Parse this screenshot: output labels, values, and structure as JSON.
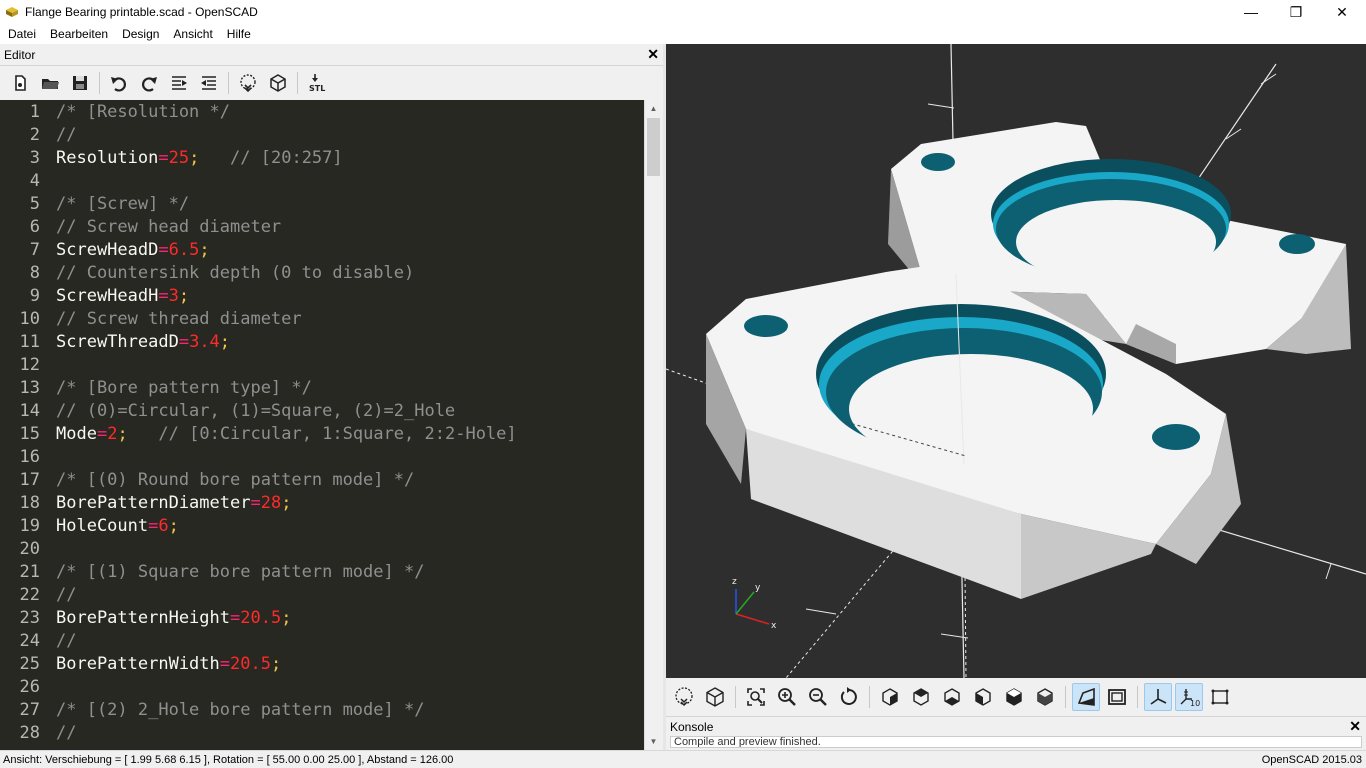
{
  "window": {
    "title": "Flange Bearing printable.scad - OpenSCAD",
    "minimize": "—",
    "maximize": "❐",
    "close": "✕"
  },
  "menu": [
    "Datei",
    "Bearbeiten",
    "Design",
    "Ansicht",
    "Hilfe"
  ],
  "editor": {
    "title": "Editor",
    "close": "✕",
    "toolbar_icons": [
      "new-file-icon",
      "open-file-icon",
      "save-icon",
      "undo-icon",
      "redo-icon",
      "indent-icon",
      "unindent-icon",
      "preview-icon",
      "render-icon",
      "export-stl-icon"
    ],
    "stl_label": "STL",
    "lines": [
      {
        "n": "1",
        "t": [
          [
            "cm",
            "/* [Resolution */"
          ]
        ]
      },
      {
        "n": "2",
        "t": [
          [
            "cm",
            "//"
          ]
        ]
      },
      {
        "n": "3",
        "t": [
          [
            "id",
            "Resolution"
          ],
          [
            "op",
            "="
          ],
          [
            "num",
            "25"
          ],
          [
            "pc",
            ";"
          ],
          [
            "cm",
            "   // [20:257]"
          ]
        ]
      },
      {
        "n": "4",
        "t": []
      },
      {
        "n": "5",
        "t": [
          [
            "cm",
            "/* [Screw] */"
          ]
        ]
      },
      {
        "n": "6",
        "t": [
          [
            "cm",
            "// Screw head diameter"
          ]
        ]
      },
      {
        "n": "7",
        "t": [
          [
            "id",
            "ScrewHeadD"
          ],
          [
            "op",
            "="
          ],
          [
            "num",
            "6.5"
          ],
          [
            "pc",
            ";"
          ]
        ]
      },
      {
        "n": "8",
        "t": [
          [
            "cm",
            "// Countersink depth (0 to disable)"
          ]
        ]
      },
      {
        "n": "9",
        "t": [
          [
            "id",
            "ScrewHeadH"
          ],
          [
            "op",
            "="
          ],
          [
            "num",
            "3"
          ],
          [
            "pc",
            ";"
          ]
        ]
      },
      {
        "n": "10",
        "t": [
          [
            "cm",
            "// Screw thread diameter"
          ]
        ]
      },
      {
        "n": "11",
        "t": [
          [
            "id",
            "ScrewThreadD"
          ],
          [
            "op",
            "="
          ],
          [
            "num",
            "3.4"
          ],
          [
            "pc",
            ";"
          ]
        ]
      },
      {
        "n": "12",
        "t": []
      },
      {
        "n": "13",
        "t": [
          [
            "cm",
            "/* [Bore pattern type] */"
          ]
        ]
      },
      {
        "n": "14",
        "t": [
          [
            "cm",
            "// (0)=Circular, (1)=Square, (2)=2_Hole"
          ]
        ]
      },
      {
        "n": "15",
        "t": [
          [
            "id",
            "Mode"
          ],
          [
            "op",
            "="
          ],
          [
            "num",
            "2"
          ],
          [
            "pc",
            ";"
          ],
          [
            "cm",
            "   // [0:Circular, 1:Square, 2:2-Hole]"
          ]
        ]
      },
      {
        "n": "16",
        "t": []
      },
      {
        "n": "17",
        "t": [
          [
            "cm",
            "/* [(0) Round bore pattern mode] */"
          ]
        ]
      },
      {
        "n": "18",
        "t": [
          [
            "id",
            "BorePatternDiameter"
          ],
          [
            "op",
            "="
          ],
          [
            "num",
            "28"
          ],
          [
            "pc",
            ";"
          ]
        ]
      },
      {
        "n": "19",
        "t": [
          [
            "id",
            "HoleCount"
          ],
          [
            "op",
            "="
          ],
          [
            "num",
            "6"
          ],
          [
            "pc",
            ";"
          ]
        ]
      },
      {
        "n": "20",
        "t": []
      },
      {
        "n": "21",
        "t": [
          [
            "cm",
            "/* [(1) Square bore pattern mode] */"
          ]
        ]
      },
      {
        "n": "22",
        "t": [
          [
            "cm",
            "//"
          ]
        ]
      },
      {
        "n": "23",
        "t": [
          [
            "id",
            "BorePatternHeight"
          ],
          [
            "op",
            "="
          ],
          [
            "num",
            "20.5"
          ],
          [
            "pc",
            ";"
          ]
        ]
      },
      {
        "n": "24",
        "t": [
          [
            "cm",
            "//"
          ]
        ]
      },
      {
        "n": "25",
        "t": [
          [
            "id",
            "BorePatternWidth"
          ],
          [
            "op",
            "="
          ],
          [
            "num",
            "20.5"
          ],
          [
            "pc",
            ";"
          ]
        ]
      },
      {
        "n": "26",
        "t": []
      },
      {
        "n": "27",
        "t": [
          [
            "cm",
            "/* [(2) 2_Hole bore pattern mode] */"
          ]
        ]
      },
      {
        "n": "28",
        "t": [
          [
            "cm",
            "//"
          ]
        ]
      }
    ]
  },
  "viewport": {
    "axis_labels": {
      "x": "x",
      "y": "y",
      "z": "z"
    },
    "colors": {
      "background": "#2e2e2e",
      "part": "#f2f2f2",
      "bore": "#1aa8c8",
      "bore_dark": "#0b5a6b"
    }
  },
  "view_toolbar": {
    "icons": [
      "preview-icon",
      "render-icon",
      "view-all-icon",
      "zoom-in-icon",
      "zoom-out-icon",
      "reset-view-icon",
      "view-right-icon",
      "view-top-icon",
      "view-bottom-icon",
      "view-left-icon",
      "view-front-icon",
      "view-back-icon",
      "perspective-icon",
      "orthogonal-icon",
      "show-axes-icon",
      "show-scale-markers-icon",
      "show-edges-icon"
    ],
    "active": [
      "perspective-icon",
      "show-axes-icon",
      "show-scale-markers-icon"
    ],
    "scale_label": "10"
  },
  "console": {
    "title": "Konsole",
    "close": "✕",
    "output": "Compile and preview finished."
  },
  "status": {
    "left": "Ansicht: Verschiebung = [ 1.99 5.68 6.15 ], Rotation = [ 55.00 0.00 25.00 ], Abstand = 126.00",
    "right": "OpenSCAD 2015.03"
  }
}
